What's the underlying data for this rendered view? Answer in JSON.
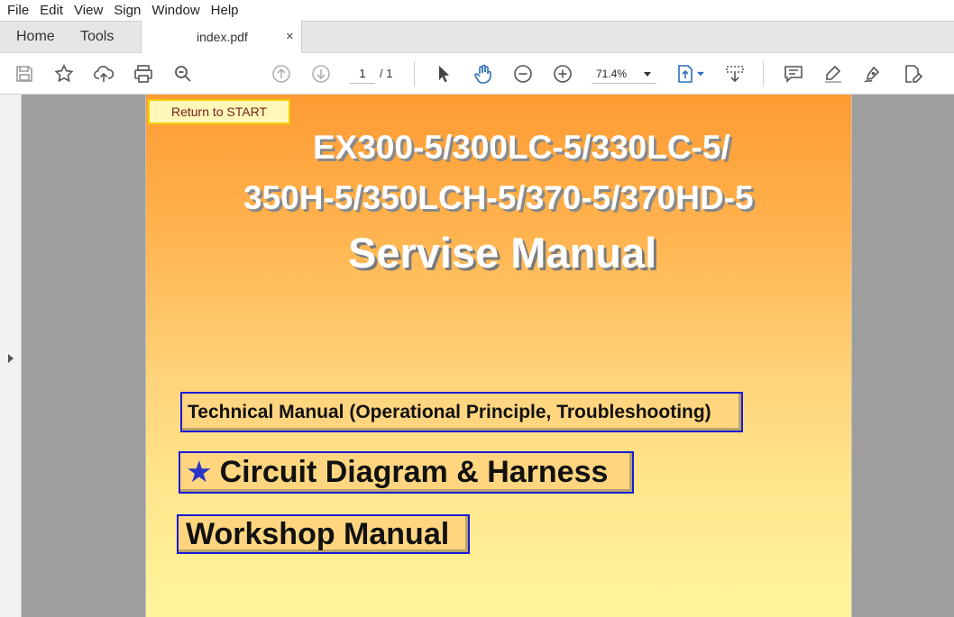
{
  "menubar": {
    "items": [
      "File",
      "Edit",
      "View",
      "Sign",
      "Window",
      "Help"
    ]
  },
  "tabs": {
    "home": "Home",
    "tools": "Tools",
    "document": "index.pdf",
    "close": "×"
  },
  "toolbar": {
    "page_current": "1",
    "page_total": "/ 1",
    "zoom": "71.4%"
  },
  "document": {
    "return_button": "Return to START",
    "title_line1": "EX300-5/300LC-5/330LC-5/",
    "title_line2": "350H-5/350LCH-5/370-5/370HD-5",
    "title_line3": "Servise Manual",
    "links": {
      "technical": "Technical Manual (Operational Principle, Troubleshooting)",
      "circuit_icon": "★",
      "circuit": "Circuit Diagram & Harness",
      "workshop": "Workshop Manual"
    }
  },
  "colors": {
    "page_gradient_top": "#ff9b33",
    "page_gradient_bottom": "#fff59a",
    "link_border": "#1a1ad6",
    "star": "#2c33c7",
    "active_tool": "#2a6ebb"
  }
}
